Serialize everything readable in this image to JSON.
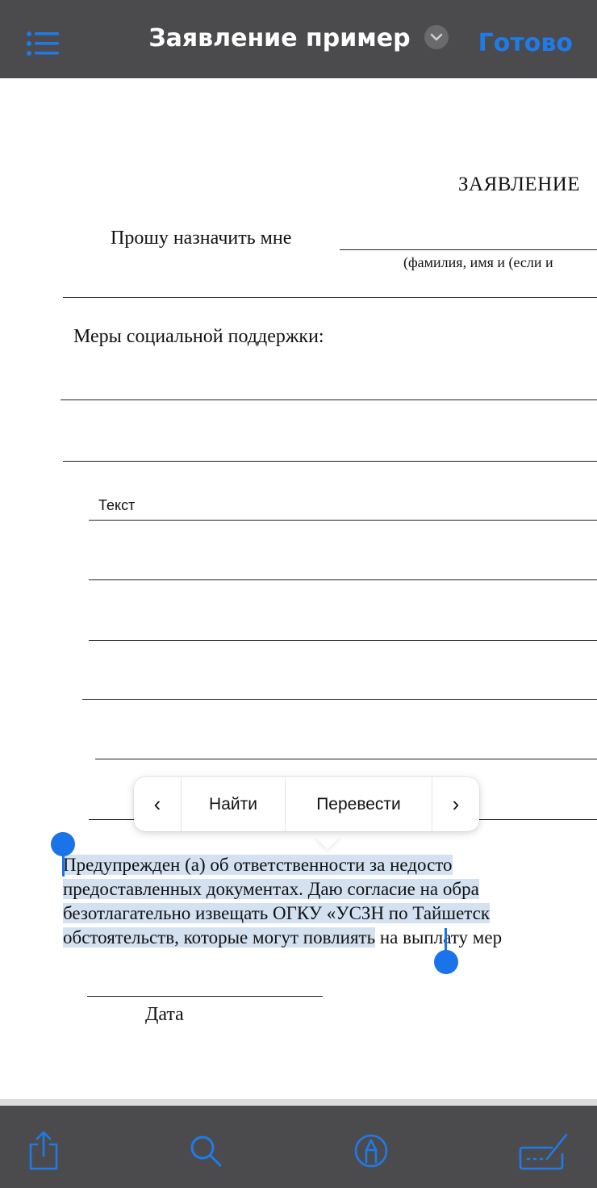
{
  "header": {
    "title": "Заявление пример",
    "done_label": "Готово"
  },
  "document": {
    "heading": "ЗАЯВЛЕНИЕ",
    "request_text": "Прошу назначить мне",
    "fio_hint": "(фамилия, имя и (если и",
    "measures_label": "Меры социальной поддержки:",
    "text_field_label": "Текст",
    "paragraph_lines": [
      "Предупрежден  (а)  об  ответственности  за  недосто",
      "предоставленных  документах.  Даю  согласие  на  обра",
      "безотлагательно  извещать  ОГКУ  «УСЗН  по  Тайшетск",
      "обстоятельств, которые могут повлиять"
    ],
    "paragraph_tail": " на выплату мер",
    "date_label": "Дата"
  },
  "context_menu": {
    "prev_label": "‹",
    "items": [
      "Найти",
      "Перевести"
    ],
    "next_label": "›"
  },
  "toolbar": {
    "icons": [
      "share-icon",
      "search-icon",
      "markup-icon",
      "signature-icon"
    ]
  },
  "colors": {
    "accent": "#1f7bea",
    "bar_background": "#4b4b4d",
    "selection": "#d4e1f1"
  }
}
